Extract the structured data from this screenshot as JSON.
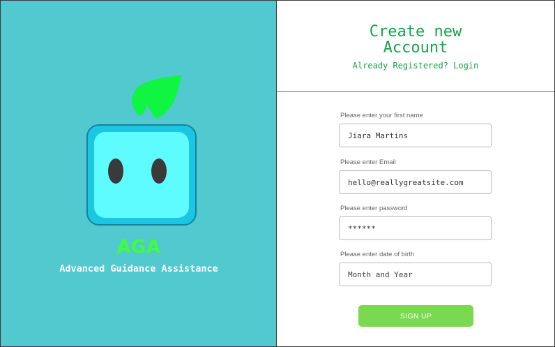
{
  "brand": {
    "name": "AGA",
    "tagline": "Advanced Guidance Assistance",
    "logo_icon": "robot-leaf-logo"
  },
  "header": {
    "title": "Create new\nAccount",
    "login_link": "Already Registered? Login"
  },
  "form": {
    "first_name": {
      "label": "Please enter your first name",
      "value": "Jiara Martins"
    },
    "email": {
      "label": "Please enter Email",
      "value": "hello@reallygreatsite.com"
    },
    "password": {
      "label": "Please enter password",
      "value": "******"
    },
    "dob": {
      "label": "Please enter date of birth",
      "placeholder": "Month and Year"
    },
    "submit_label": "SIGN UP"
  },
  "colors": {
    "left_panel": "#52c8cf",
    "accent_green": "#17a24a",
    "brand_green": "#3dff3a",
    "button_green": "#7bd951"
  }
}
